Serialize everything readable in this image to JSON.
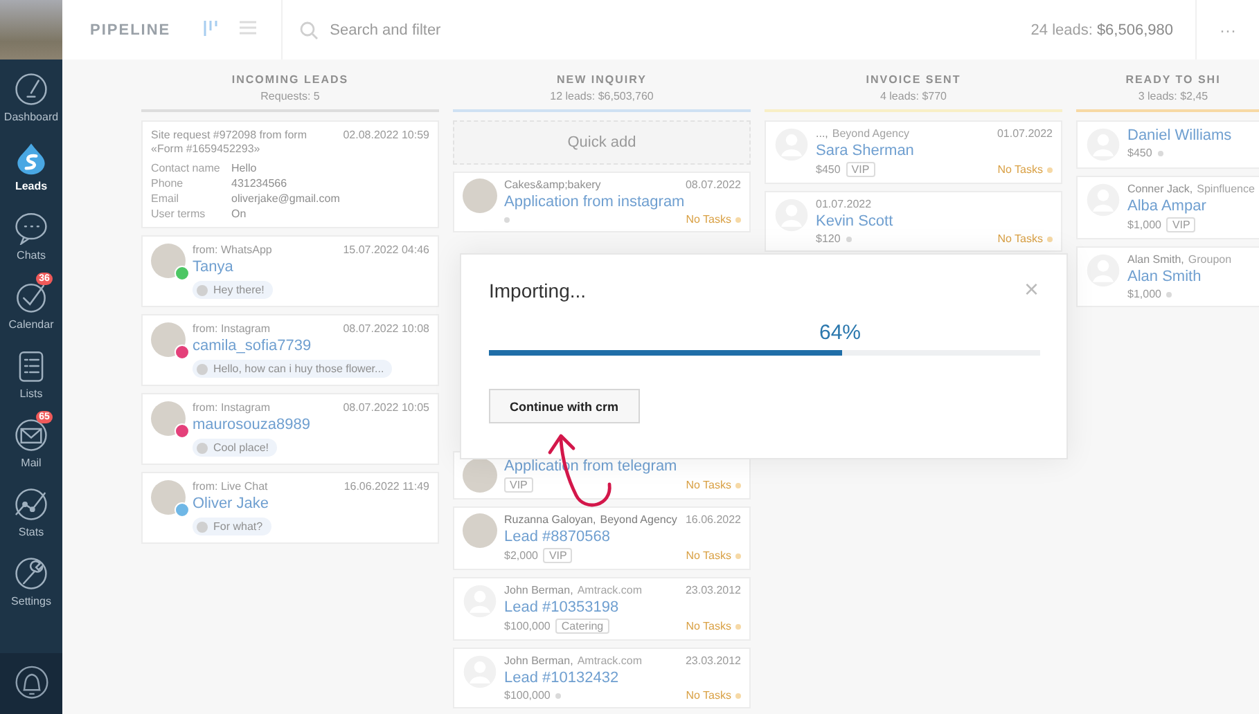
{
  "sidebar": {
    "items": [
      {
        "label": "Dashboard",
        "kind": "gauge",
        "selected": false
      },
      {
        "label": "Leads",
        "kind": "drop",
        "selected": true
      },
      {
        "label": "Chats",
        "kind": "chat",
        "selected": false
      },
      {
        "label": "Calendar",
        "kind": "check",
        "selected": false,
        "badge": "36"
      },
      {
        "label": "Lists",
        "kind": "list",
        "selected": false
      },
      {
        "label": "Mail",
        "kind": "mail",
        "selected": false,
        "badge": "65"
      },
      {
        "label": "Stats",
        "kind": "graph",
        "selected": false
      },
      {
        "label": "Settings",
        "kind": "wrench",
        "selected": false
      }
    ]
  },
  "topbar": {
    "title": "PIPELINE",
    "views": [
      {
        "kind": "board",
        "selected": true
      },
      {
        "kind": "list",
        "selected": false
      }
    ],
    "search": {
      "placeholder": "Search and filter"
    },
    "total_label": "24 leads:",
    "total_value": "$6,506,980",
    "menu": "···"
  },
  "columns": [
    {
      "title": "INCOMING LEADS",
      "subtitle": "Requests: 5",
      "color": "#dddddd",
      "cards": [
        {
          "kind": "form",
          "title": "Site request #972098 from form «Form #1659452293»",
          "date": "02.08.2022 10:59",
          "fields": [
            {
              "label": "Contact name",
              "value": "Hello"
            },
            {
              "label": "Phone",
              "value": "431234566"
            },
            {
              "label": "Email",
              "value": "oliverjake@gmail.com"
            },
            {
              "label": "User terms",
              "value": "On"
            }
          ]
        },
        {
          "kind": "chat",
          "source": "from: WhatsApp",
          "date": "15.07.2022 04:46",
          "name": "Tanya",
          "color": "#4cc764",
          "message": "Hey there!"
        },
        {
          "kind": "chat",
          "source": "from: Instagram",
          "date": "08.07.2022 10:08",
          "name": "camila_sofia7739",
          "color": "#e4407a",
          "message": "Hello, how can i huy those flower..."
        },
        {
          "kind": "chat",
          "source": "from: Instagram",
          "date": "08.07.2022 10:05",
          "name": "maurosouza8989",
          "color": "#e4407a",
          "message": "Cool place!"
        },
        {
          "kind": "chat",
          "source": "from: Live Chat",
          "date": "16.06.2022 11:49",
          "name": "Oliver Jake",
          "color": "#6fb7e6",
          "message": "For what?"
        }
      ]
    },
    {
      "title": "NEW INQUIRY",
      "subtitle": "12 leads: $6,503,760",
      "color": "#cfe1f3",
      "quick_add": "Quick add",
      "cards": [
        {
          "kind": "lead",
          "photo": true,
          "contact": "Cakes&amp;bakery",
          "date": "08.07.2022",
          "title": "Application from instagram",
          "tasks": "No Tasks"
        },
        {
          "kind": "lead",
          "photo": true,
          "title": "Application from telegram",
          "tag": "VIP",
          "tasks": "No Tasks"
        },
        {
          "kind": "lead",
          "photo": true,
          "contact": "Ruzanna Galoyan,",
          "company": "Beyond Agency",
          "date": "16.06.2022",
          "title": "Lead #8870568",
          "price": "$2,000",
          "tag": "VIP",
          "tasks": "No Tasks"
        },
        {
          "kind": "lead",
          "photo": false,
          "contact": "John Berman,",
          "company": "Amtrack.com",
          "date": "23.03.2012",
          "title": "Lead #10353198",
          "price": "$100,000",
          "tag": "Catering",
          "tasks": "No Tasks"
        },
        {
          "kind": "lead",
          "photo": false,
          "contact": "John Berman,",
          "company": "Amtrack.com",
          "date": "23.03.2012",
          "title": "Lead #10132432",
          "price": "$100,000",
          "tasks": "No Tasks"
        }
      ]
    },
    {
      "title": "INVOICE SENT",
      "subtitle": "4 leads: $770",
      "color": "#f8efc6",
      "cards": [
        {
          "kind": "lead",
          "photo": false,
          "contact": "...,",
          "company": "Beyond Agency",
          "date": "01.07.2022",
          "title": "Sara Sherman",
          "price": "$450",
          "tag": "VIP",
          "tasks": "No Tasks"
        },
        {
          "kind": "lead",
          "photo": false,
          "date": "01.07.2022",
          "title": "Kevin Scott",
          "price": "$120",
          "tasks": "No Tasks"
        }
      ]
    },
    {
      "title": "READY TO SHI",
      "subtitle": "3 leads: $2,45",
      "color": "#f7d9a4",
      "cards": [
        {
          "kind": "lead",
          "photo": false,
          "title": "Daniel Williams",
          "price": "$450"
        },
        {
          "kind": "lead",
          "photo": false,
          "contact": "Conner Jack,",
          "company": "Spinfluence",
          "title": "Alba Ampar",
          "price": "$1,000",
          "tag": "VIP"
        },
        {
          "kind": "lead",
          "photo": false,
          "contact": "Alan Smith,",
          "company": "Groupon",
          "title": "Alan Smith",
          "price": "$1,000"
        }
      ]
    }
  ],
  "modal": {
    "title": "Importing...",
    "close": "×",
    "percent": "64%",
    "level": 0.64,
    "button": "Continue with crm"
  }
}
